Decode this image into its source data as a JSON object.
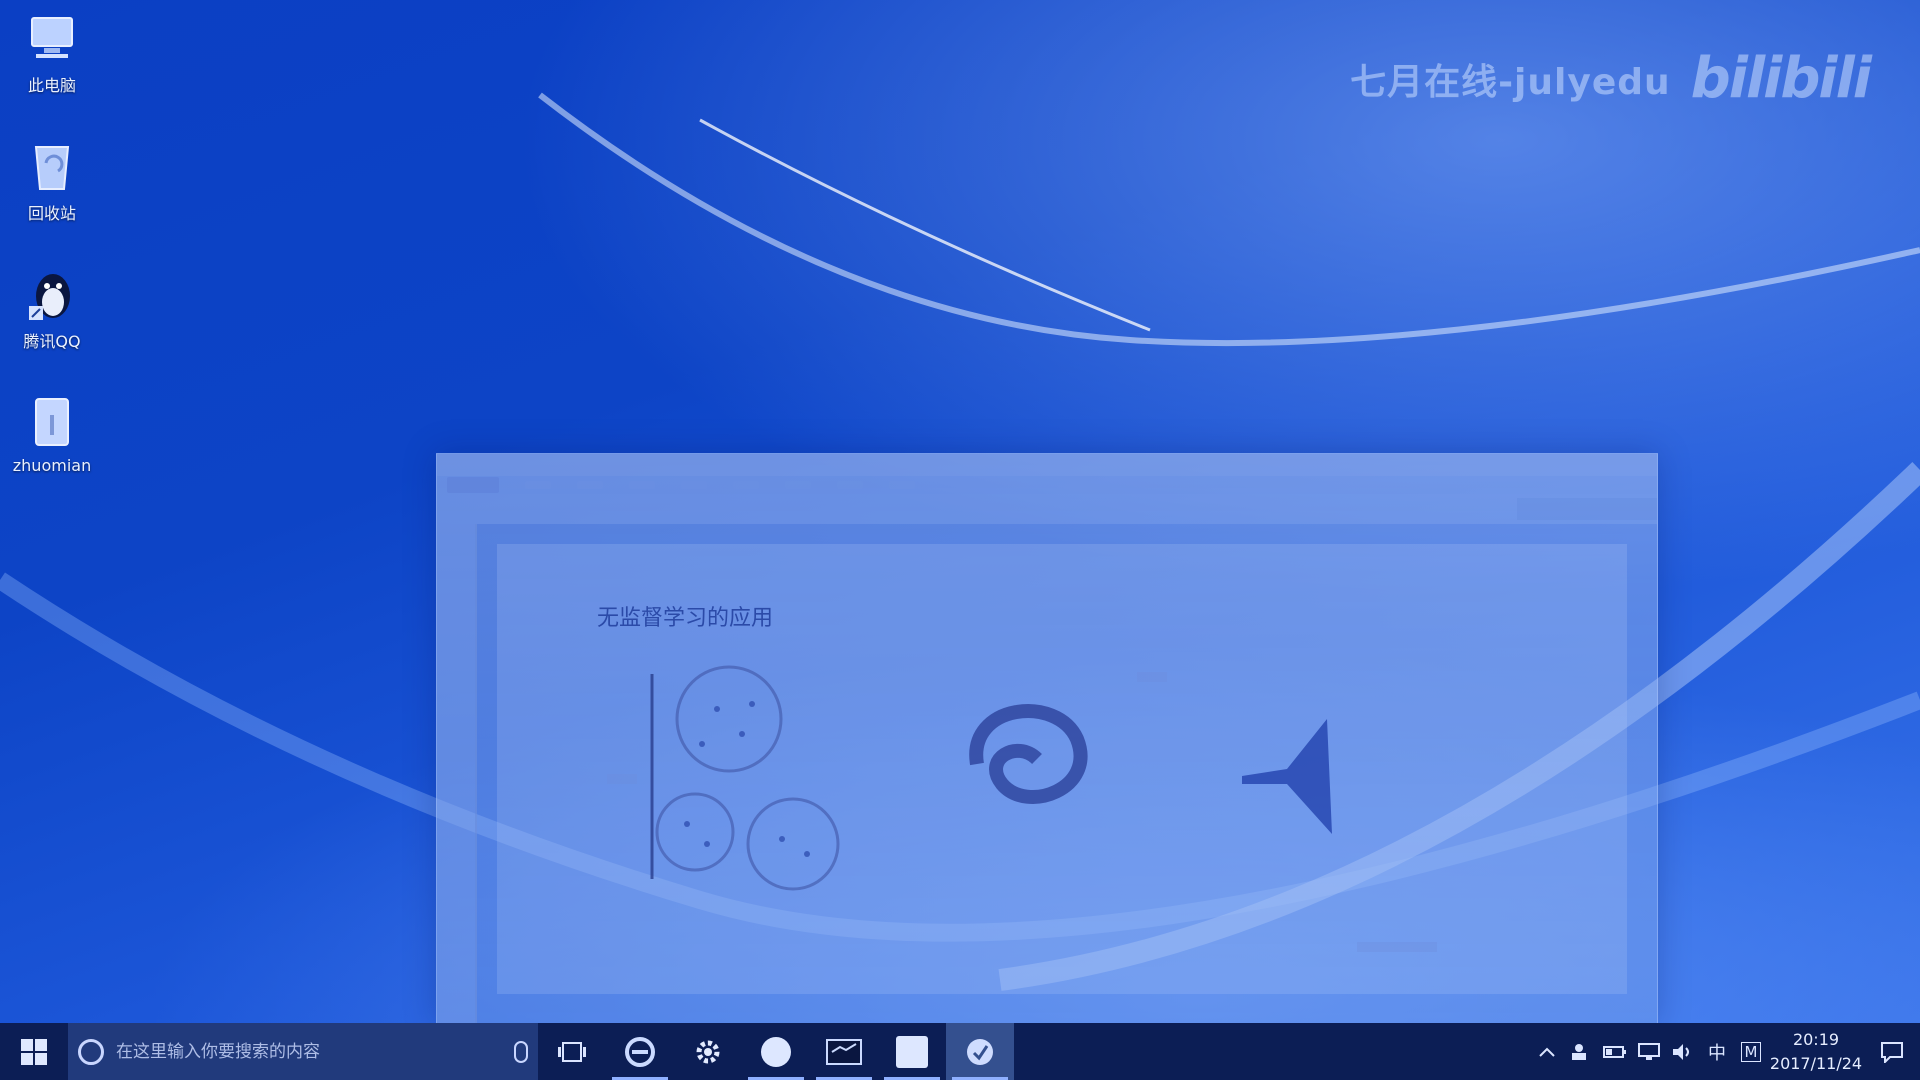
{
  "watermark": {
    "text": "七月在线-julyedu",
    "logo": "bilibili"
  },
  "desktop_icons": [
    {
      "label": "此电脑",
      "icon": "computer-icon"
    },
    {
      "label": "回收站",
      "icon": "recycle-bin-icon"
    },
    {
      "label": "腾讯QQ",
      "icon": "qq-penguin-icon"
    },
    {
      "label": "zhuomian",
      "icon": "folder-icon"
    }
  ],
  "window": {
    "slide_title": "无监督学习的应用"
  },
  "taskbar": {
    "search_placeholder": "在这里输入你要搜索的内容",
    "apps": [
      {
        "name": "task-view-icon"
      },
      {
        "name": "browser-icon"
      },
      {
        "name": "settings-icon"
      },
      {
        "name": "app-circle-icon"
      },
      {
        "name": "terminal-icon"
      },
      {
        "name": "app-square-icon"
      },
      {
        "name": "presentation-icon"
      }
    ],
    "tray": {
      "ime": "中",
      "ime2": "M",
      "time": "20:19",
      "date": "2017/11/24"
    }
  },
  "colors": {
    "taskbar": "#0c1e55",
    "search_box": "#213a7c",
    "desktop_blue": "#0d44c6"
  }
}
